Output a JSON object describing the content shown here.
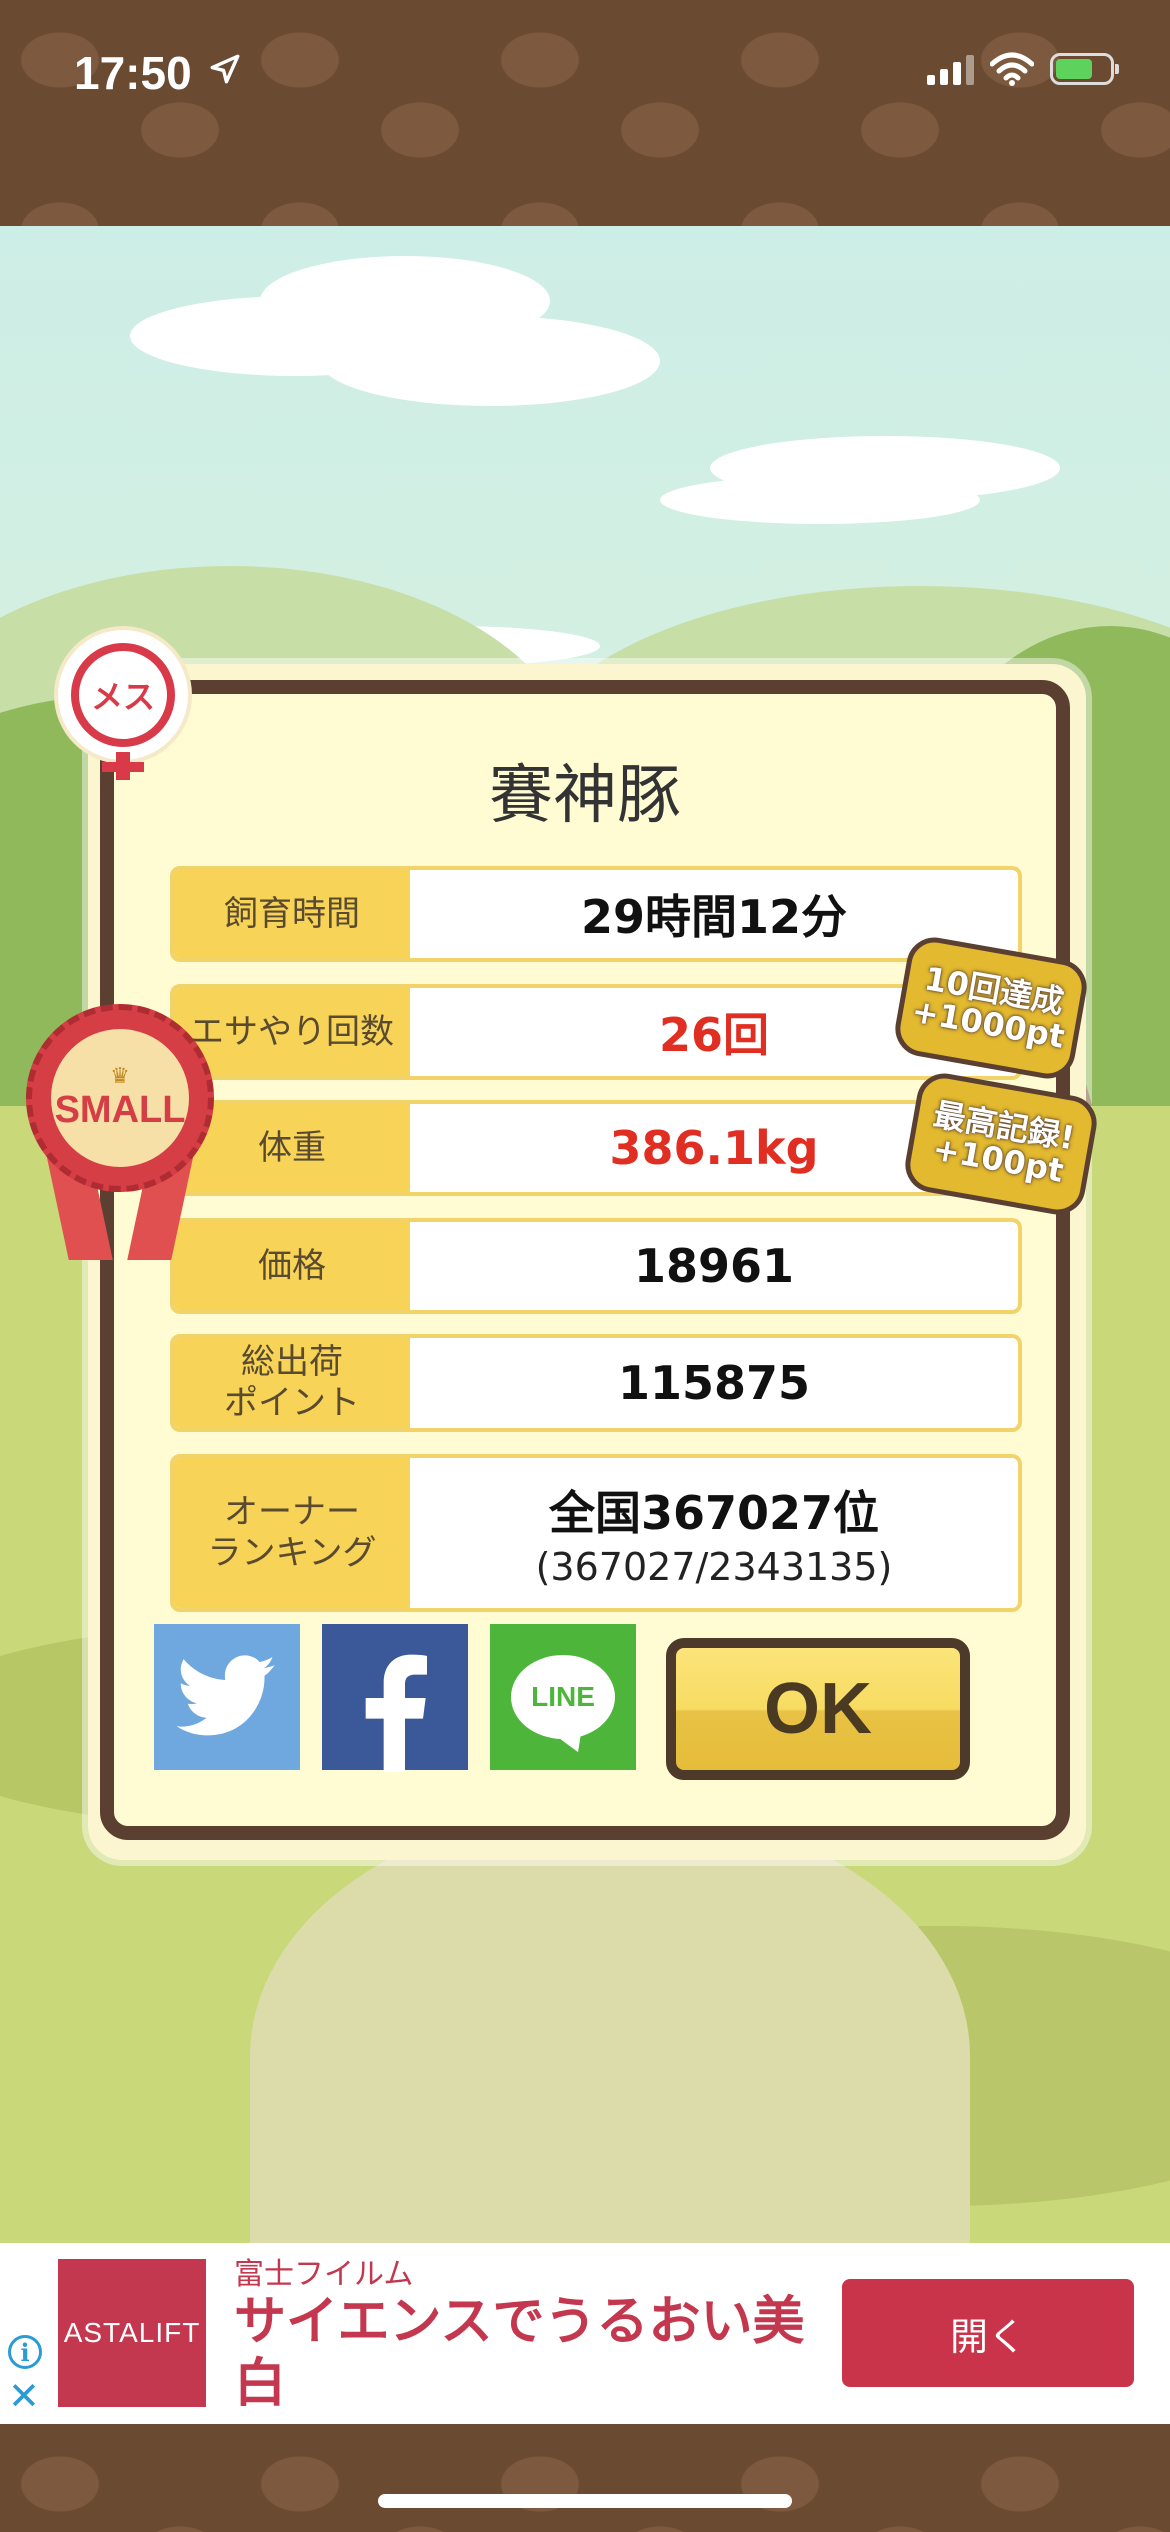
{
  "status_bar": {
    "time": "17:50"
  },
  "panel": {
    "title": "賽神豚",
    "rows": [
      {
        "label": "飼育時間",
        "value": "29時間12分"
      },
      {
        "label": "エサやり回数",
        "value": "26回"
      },
      {
        "label": "体重",
        "value": "386.1kg"
      },
      {
        "label": "価格",
        "value": "18961"
      },
      {
        "label": "総出荷\nポイント",
        "value": "115875"
      },
      {
        "label": "オーナー\nランキング",
        "value": "全国367027位",
        "sub": "(367027/2343135)"
      }
    ],
    "ok_label": "OK",
    "line_label": "LINE"
  },
  "badges": {
    "gender": "メス",
    "size": "SMALL",
    "achievement_1_line1": "10回達成",
    "achievement_1_line2": "+1000pt",
    "achievement_2_line1": "最高記録!",
    "achievement_2_line2": "+100pt"
  },
  "ad": {
    "logo_text": "ASTALIFT",
    "brand": "富士フイルム",
    "headline": "サイエンスでうるおい美白",
    "button": "開く"
  },
  "colors": {
    "panel_border": "#5b4032",
    "label_bg": "#f7d457",
    "highlight_red": "#e02e23",
    "twitter": "#6ea8de",
    "facebook": "#3b5998",
    "line": "#4cb53a",
    "ad_red": "#c9344a"
  }
}
